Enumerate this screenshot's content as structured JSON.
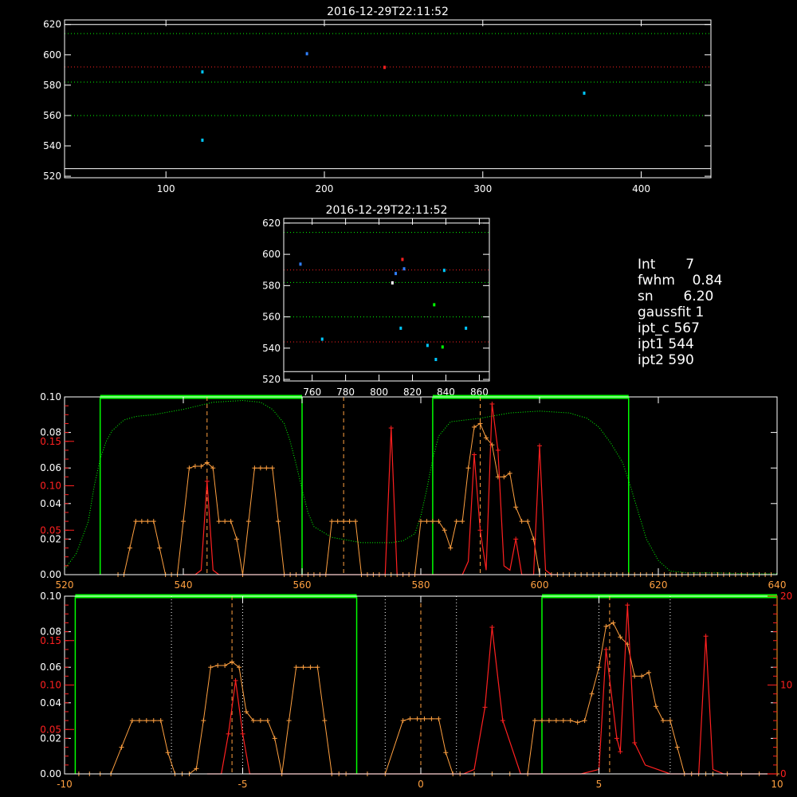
{
  "colors": {
    "white": "#ffffff",
    "green": "#00ff00",
    "red": "#ff2020",
    "orange": "#ffa040",
    "cyan": "#00c8ff",
    "blue": "#3080ff"
  },
  "info": {
    "lines": [
      {
        "key": "Int",
        "value": "7"
      },
      {
        "key": "fwhm",
        "value": "0.84"
      },
      {
        "key": "sn",
        "value": "6.20"
      },
      {
        "key": "gaussfit",
        "value": "1"
      },
      {
        "key": "ipt_c",
        "value": "567"
      },
      {
        "key": "ipt1",
        "value": "544"
      },
      {
        "key": "ipt2",
        "value": "590"
      }
    ]
  },
  "chart_data": [
    {
      "id": "top",
      "type": "scatter",
      "title": "2016-12-29T22:11:52",
      "xlim": [
        36,
        444
      ],
      "ylim": [
        519,
        623
      ],
      "xticks": [
        100,
        200,
        300,
        400
      ],
      "yticks": [
        520,
        540,
        560,
        580,
        600,
        620
      ],
      "hlines": [
        {
          "y": 525,
          "color": "white",
          "style": "solid"
        },
        {
          "y": 560,
          "color": "green",
          "style": "dotted"
        },
        {
          "y": 582,
          "color": "green",
          "style": "dotted"
        },
        {
          "y": 592,
          "color": "red",
          "style": "dotted"
        },
        {
          "y": 614,
          "color": "green",
          "style": "dotted"
        },
        {
          "y": 620,
          "color": "white",
          "style": "solid"
        }
      ],
      "points": [
        {
          "x": 123,
          "y": 589,
          "color": "cyan"
        },
        {
          "x": 123,
          "y": 544,
          "color": "cyan"
        },
        {
          "x": 189,
          "y": 601,
          "color": "blue"
        },
        {
          "x": 238,
          "y": 592,
          "color": "red"
        },
        {
          "x": 364,
          "y": 575,
          "color": "cyan"
        }
      ]
    },
    {
      "id": "mid",
      "type": "scatter",
      "title": "2016-12-29T22:11:52",
      "xlim": [
        743,
        866
      ],
      "ylim": [
        519,
        623
      ],
      "xticks": [
        760,
        780,
        800,
        820,
        840,
        860
      ],
      "yticks": [
        520,
        540,
        560,
        580,
        600,
        620
      ],
      "hlines": [
        {
          "y": 525,
          "color": "white",
          "style": "solid"
        },
        {
          "y": 544,
          "color": "red",
          "style": "dotted"
        },
        {
          "y": 560,
          "color": "green",
          "style": "dotted"
        },
        {
          "y": 582,
          "color": "green",
          "style": "dotted"
        },
        {
          "y": 590,
          "color": "red",
          "style": "dotted"
        },
        {
          "y": 614,
          "color": "green",
          "style": "dotted"
        },
        {
          "y": 620,
          "color": "white",
          "style": "solid"
        }
      ],
      "points": [
        {
          "x": 753,
          "y": 594,
          "color": "blue"
        },
        {
          "x": 766,
          "y": 546,
          "color": "cyan"
        },
        {
          "x": 808,
          "y": 582,
          "color": "white"
        },
        {
          "x": 810,
          "y": 588,
          "color": "blue"
        },
        {
          "x": 813,
          "y": 553,
          "color": "cyan"
        },
        {
          "x": 814,
          "y": 597,
          "color": "red"
        },
        {
          "x": 815,
          "y": 591,
          "color": "blue"
        },
        {
          "x": 829,
          "y": 542,
          "color": "cyan"
        },
        {
          "x": 833,
          "y": 568,
          "color": "green"
        },
        {
          "x": 834,
          "y": 533,
          "color": "cyan"
        },
        {
          "x": 838,
          "y": 541,
          "color": "green"
        },
        {
          "x": 839,
          "y": 590,
          "color": "cyan"
        },
        {
          "x": 852,
          "y": 553,
          "color": "cyan"
        }
      ]
    },
    {
      "id": "spectrum",
      "type": "line",
      "xlim": [
        520,
        640
      ],
      "ylim": [
        0,
        0.1
      ],
      "xticks": [
        520,
        540,
        560,
        580,
        600,
        620,
        640
      ],
      "yticks_left": [
        0.0,
        0.02,
        0.04,
        0.06,
        0.08,
        0.1
      ],
      "yticks_left_labels": [
        "0.00",
        "0.02",
        "0.04",
        "0.06",
        "0.08",
        "0.10"
      ],
      "red_ylim": [
        0,
        0.2
      ],
      "red_yticks": [
        0.05,
        0.1,
        0.15
      ],
      "red_yticks_labels": [
        "0.05",
        "0.10",
        "0.15"
      ],
      "green_bands": [
        [
          526,
          560
        ],
        [
          582,
          615
        ]
      ],
      "vlines": [
        {
          "x": 544,
          "color": "orange",
          "style": "dashed"
        },
        {
          "x": 567,
          "color": "orange",
          "style": "dashed"
        },
        {
          "x": 590,
          "color": "orange",
          "style": "dashed"
        }
      ],
      "filter": {
        "x": [
          520,
          522,
          524,
          525,
          526,
          527,
          528,
          530,
          532,
          535,
          540,
          545,
          550,
          553,
          555,
          557,
          558,
          559,
          560,
          561,
          562,
          565,
          570,
          575,
          577,
          579,
          580,
          581,
          582,
          583,
          585,
          590,
          595,
          600,
          605,
          608,
          610,
          612,
          614,
          615,
          616,
          618,
          620,
          622,
          625,
          630,
          635,
          640
        ],
        "y": [
          0.003,
          0.012,
          0.03,
          0.05,
          0.065,
          0.075,
          0.081,
          0.087,
          0.089,
          0.09,
          0.093,
          0.097,
          0.098,
          0.097,
          0.093,
          0.085,
          0.075,
          0.062,
          0.048,
          0.035,
          0.027,
          0.021,
          0.018,
          0.018,
          0.019,
          0.023,
          0.033,
          0.048,
          0.065,
          0.078,
          0.086,
          0.088,
          0.091,
          0.092,
          0.091,
          0.088,
          0.083,
          0.074,
          0.063,
          0.053,
          0.042,
          0.02,
          0.008,
          0.002,
          0.001,
          0.001,
          0.0005,
          0.0005
        ]
      },
      "orange": {
        "x": [
          529,
          530,
          531,
          532,
          533,
          534,
          535,
          536,
          537,
          538,
          539,
          540,
          541,
          542,
          543,
          544,
          545,
          546,
          547,
          548,
          549,
          550,
          551,
          552,
          553,
          554,
          555,
          556,
          557,
          558,
          559,
          560,
          561,
          562,
          563,
          564,
          565,
          566,
          567,
          568,
          569,
          570,
          571,
          572,
          573,
          574,
          575,
          576,
          577,
          578,
          579,
          580,
          581,
          582,
          583,
          584,
          585,
          586,
          587,
          588,
          589,
          590,
          591,
          592,
          593,
          594,
          595,
          596,
          597,
          598,
          599,
          600,
          601,
          602,
          603,
          604,
          605,
          606,
          607,
          608,
          609,
          610,
          611,
          612,
          613,
          614,
          615,
          616,
          617,
          618,
          619,
          620,
          621,
          622,
          623,
          624,
          625,
          626,
          627,
          628,
          629,
          630,
          631,
          632,
          633,
          634,
          635,
          636,
          637,
          638,
          639
        ],
        "y": [
          0,
          0,
          0.015,
          0.03,
          0.03,
          0.03,
          0.03,
          0.015,
          0,
          0,
          0,
          0.03,
          0.06,
          0.061,
          0.061,
          0.063,
          0.06,
          0.03,
          0.03,
          0.03,
          0.02,
          0,
          0.03,
          0.06,
          0.06,
          0.06,
          0.06,
          0.03,
          0,
          0,
          0,
          0,
          0,
          0,
          0,
          0,
          0.03,
          0.03,
          0.03,
          0.03,
          0.03,
          0,
          0,
          0,
          0,
          0,
          0,
          0,
          0,
          0,
          0,
          0.03,
          0.03,
          0.03,
          0.03,
          0.025,
          0.015,
          0.03,
          0.03,
          0.06,
          0.083,
          0.085,
          0.077,
          0.073,
          0.055,
          0.055,
          0.057,
          0.038,
          0.03,
          0.03,
          0.02,
          0,
          0,
          0,
          0,
          0,
          0,
          0,
          0,
          0,
          0,
          0,
          0,
          0,
          0,
          0,
          0,
          0,
          0,
          0,
          0,
          0,
          0,
          0,
          0,
          0,
          0,
          0,
          0,
          0,
          0,
          0,
          0,
          0,
          0,
          0,
          0,
          0,
          0,
          0,
          0
        ]
      },
      "red": {
        "x": [
          540,
          541,
          542,
          543,
          544,
          545,
          546,
          547,
          548,
          549,
          550,
          551,
          552,
          553,
          554,
          555,
          556,
          557,
          558,
          559,
          560,
          561,
          562,
          563,
          564,
          565,
          566,
          567,
          568,
          569,
          570,
          571,
          572,
          573,
          574,
          575,
          576,
          577,
          578,
          579,
          580,
          581,
          582,
          583,
          584,
          585,
          586,
          587,
          588,
          589,
          590,
          591,
          592,
          593,
          594,
          595,
          596,
          597,
          598,
          599,
          600,
          601,
          602,
          603
        ],
        "y": [
          0,
          0,
          0,
          0.005,
          0.105,
          0.005,
          0,
          0,
          0,
          0,
          0,
          0,
          0,
          0,
          0,
          0,
          0,
          0,
          0,
          0,
          0,
          0,
          0,
          0,
          0,
          0,
          0,
          0,
          0,
          0,
          0,
          0,
          0,
          0,
          0,
          0.165,
          0,
          0,
          0,
          0,
          0,
          0,
          0,
          0,
          0,
          0,
          0,
          0,
          0.015,
          0.135,
          0.05,
          0.005,
          0.192,
          0.14,
          0.01,
          0.005,
          0.04,
          0,
          0,
          0,
          0.145,
          0.005,
          0,
          0
        ]
      }
    },
    {
      "id": "velocity",
      "type": "line",
      "xlim": [
        -10,
        10
      ],
      "ylim": [
        0,
        0.1
      ],
      "xticks": [
        -10,
        -5,
        0,
        5,
        10
      ],
      "yticks_left": [
        0.0,
        0.02,
        0.04,
        0.06,
        0.08,
        0.1
      ],
      "yticks_left_labels": [
        "0.00",
        "0.02",
        "0.04",
        "0.06",
        "0.08",
        "0.10"
      ],
      "red_ylim": [
        0,
        0.2
      ],
      "red_yticks": [
        0.05,
        0.1,
        0.15
      ],
      "red_yticks_labels": [
        "0.05",
        "0.10",
        "0.15"
      ],
      "right_ylim": [
        0,
        20
      ],
      "right_yticks": [
        0,
        10,
        20
      ],
      "right_yticks_labels": [
        "0",
        "10",
        "20"
      ],
      "green_bands": [
        [
          -9.7,
          -1.8
        ],
        [
          3.4,
          10
        ]
      ],
      "vlines": [
        {
          "x": -5.3,
          "color": "orange",
          "style": "dashed"
        },
        {
          "x": 0,
          "color": "orange",
          "style": "dashed"
        },
        {
          "x": 5.3,
          "color": "orange",
          "style": "dashed"
        },
        {
          "x": -7.0,
          "color": "white",
          "style": "dotted"
        },
        {
          "x": -5.0,
          "color": "white",
          "style": "dotted"
        },
        {
          "x": -1.0,
          "color": "white",
          "style": "dotted"
        },
        {
          "x": 1.0,
          "color": "white",
          "style": "dotted"
        },
        {
          "x": 5.0,
          "color": "white",
          "style": "dotted"
        },
        {
          "x": 7.0,
          "color": "white",
          "style": "dotted"
        }
      ],
      "orange": {
        "x": [
          -9.6,
          -9.3,
          -9.0,
          -8.7,
          -8.4,
          -8.1,
          -7.9,
          -7.7,
          -7.5,
          -7.3,
          -7.1,
          -6.9,
          -6.7,
          -6.5,
          -6.3,
          -6.1,
          -5.9,
          -5.7,
          -5.5,
          -5.3,
          -5.1,
          -4.9,
          -4.7,
          -4.5,
          -4.3,
          -4.1,
          -3.9,
          -3.7,
          -3.5,
          -3.3,
          -3.1,
          -2.9,
          -2.7,
          -2.5,
          -2.3,
          -2.1,
          -1.5,
          -1.0,
          -0.5,
          -0.3,
          -0.1,
          0.1,
          0.3,
          0.5,
          0.7,
          0.9,
          1.1,
          1.5,
          2.0,
          2.5,
          3.0,
          3.2,
          3.4,
          3.6,
          3.8,
          4.0,
          4.2,
          4.4,
          4.6,
          4.8,
          5.0,
          5.2,
          5.4,
          5.6,
          5.8,
          6.0,
          6.2,
          6.4,
          6.6,
          6.8,
          7.0,
          7.2,
          7.4,
          7.6,
          7.8,
          8.0,
          8.2,
          8.6,
          9.0,
          9.5,
          10.0
        ],
        "y": [
          0,
          0,
          0,
          0,
          0.015,
          0.03,
          0.03,
          0.03,
          0.03,
          0.03,
          0.012,
          0,
          0,
          0,
          0.003,
          0.03,
          0.06,
          0.061,
          0.061,
          0.063,
          0.06,
          0.035,
          0.03,
          0.03,
          0.03,
          0.02,
          0,
          0.03,
          0.06,
          0.06,
          0.06,
          0.06,
          0.03,
          0,
          0,
          0,
          0,
          0,
          0.03,
          0.031,
          0.031,
          0.031,
          0.031,
          0.031,
          0.012,
          0,
          0,
          0,
          0,
          0,
          0,
          0.03,
          0.03,
          0.03,
          0.03,
          0.03,
          0.03,
          0.029,
          0.03,
          0.045,
          0.06,
          0.083,
          0.085,
          0.077,
          0.073,
          0.055,
          0.055,
          0.057,
          0.038,
          0.03,
          0.03,
          0.015,
          0,
          0,
          0,
          0,
          0,
          0,
          0,
          0,
          0
        ]
      },
      "red": {
        "x": [
          -6.0,
          -5.6,
          -5.4,
          -5.2,
          -5.0,
          -4.8,
          1.2,
          1.5,
          1.8,
          2.0,
          2.3,
          2.8,
          3.5,
          4.5,
          5.0,
          5.2,
          5.5,
          5.6,
          5.8,
          6.0,
          6.3,
          7.0,
          7.8,
          8.0,
          8.2,
          8.5,
          9.0,
          10.0
        ],
        "y": [
          0,
          0,
          0.045,
          0.105,
          0.045,
          0,
          0,
          0.005,
          0.075,
          0.165,
          0.06,
          0,
          0,
          0,
          0.005,
          0.14,
          0.04,
          0.025,
          0.19,
          0.035,
          0.01,
          0,
          0,
          0.155,
          0.005,
          0,
          0,
          0
        ]
      }
    }
  ]
}
